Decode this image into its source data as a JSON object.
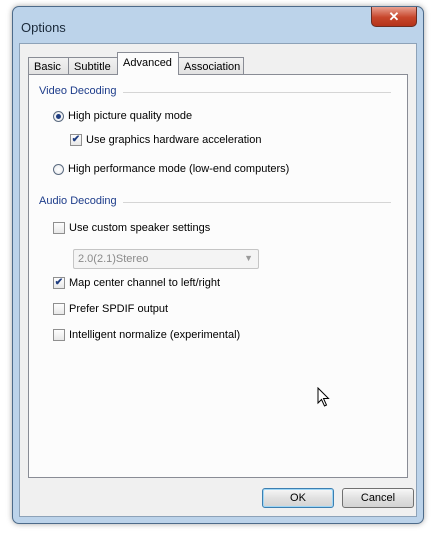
{
  "window": {
    "title": "Options",
    "close_glyph": "✕"
  },
  "tabs": [
    {
      "label": "Basic"
    },
    {
      "label": "Subtitle"
    },
    {
      "label": "Advanced"
    },
    {
      "label": "Association"
    }
  ],
  "active_tab": "Advanced",
  "video_decoding": {
    "group_label": "Video Decoding",
    "high_quality_label": "High picture quality mode",
    "high_quality_selected": true,
    "hw_accel_label": "Use graphics hardware acceleration",
    "hw_accel_checked": true,
    "high_performance_label": "High performance mode (low-end computers)",
    "high_performance_selected": false
  },
  "audio_decoding": {
    "group_label": "Audio Decoding",
    "custom_speaker_label": "Use custom speaker settings",
    "custom_speaker_checked": false,
    "speaker_select_value": "2.0(2.1)Stereo",
    "speaker_select_disabled": true,
    "map_center_label": "Map center channel to left/right",
    "map_center_checked": true,
    "spdif_label": "Prefer SPDIF output",
    "spdif_checked": false,
    "normalize_label": "Intelligent normalize (experimental)",
    "normalize_checked": false
  },
  "buttons": {
    "ok": "OK",
    "cancel": "Cancel"
  },
  "icons": {
    "checkmark": "✔",
    "dropdown": "▼"
  }
}
